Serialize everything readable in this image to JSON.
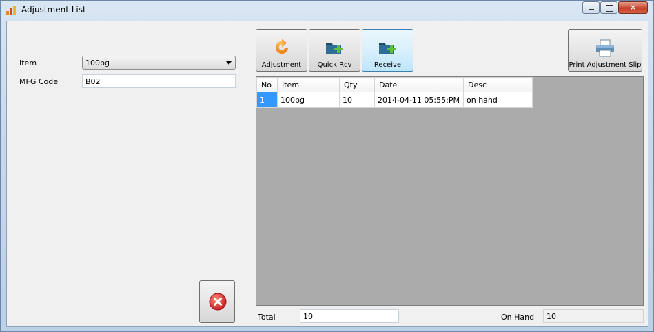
{
  "window": {
    "title": "Adjustment List",
    "icon": "bar-chart-icon"
  },
  "form": {
    "item_label": "Item",
    "item_value": "100pg",
    "mfg_label": "MFG Code",
    "mfg_value": "B02"
  },
  "toolbar": {
    "adjustment_label": "Adjustment",
    "quick_rcv_label": "Quick Rcv",
    "receive_label": "Receive",
    "print_label": "Print Adjustment Slip"
  },
  "grid": {
    "columns": [
      "No",
      "Item",
      "Qty",
      "Date",
      "Desc"
    ],
    "rows": [
      [
        "1",
        "100pg",
        "10",
        "2014-04-11 05:55:PM",
        "on hand"
      ]
    ]
  },
  "footer": {
    "total_label": "Total",
    "total_value": "10",
    "onhand_label": "On Hand",
    "onhand_value": "10"
  },
  "colors": {
    "selection": "#3399ff",
    "grid_background": "#ababab",
    "cancel_red": "#d9262b"
  }
}
